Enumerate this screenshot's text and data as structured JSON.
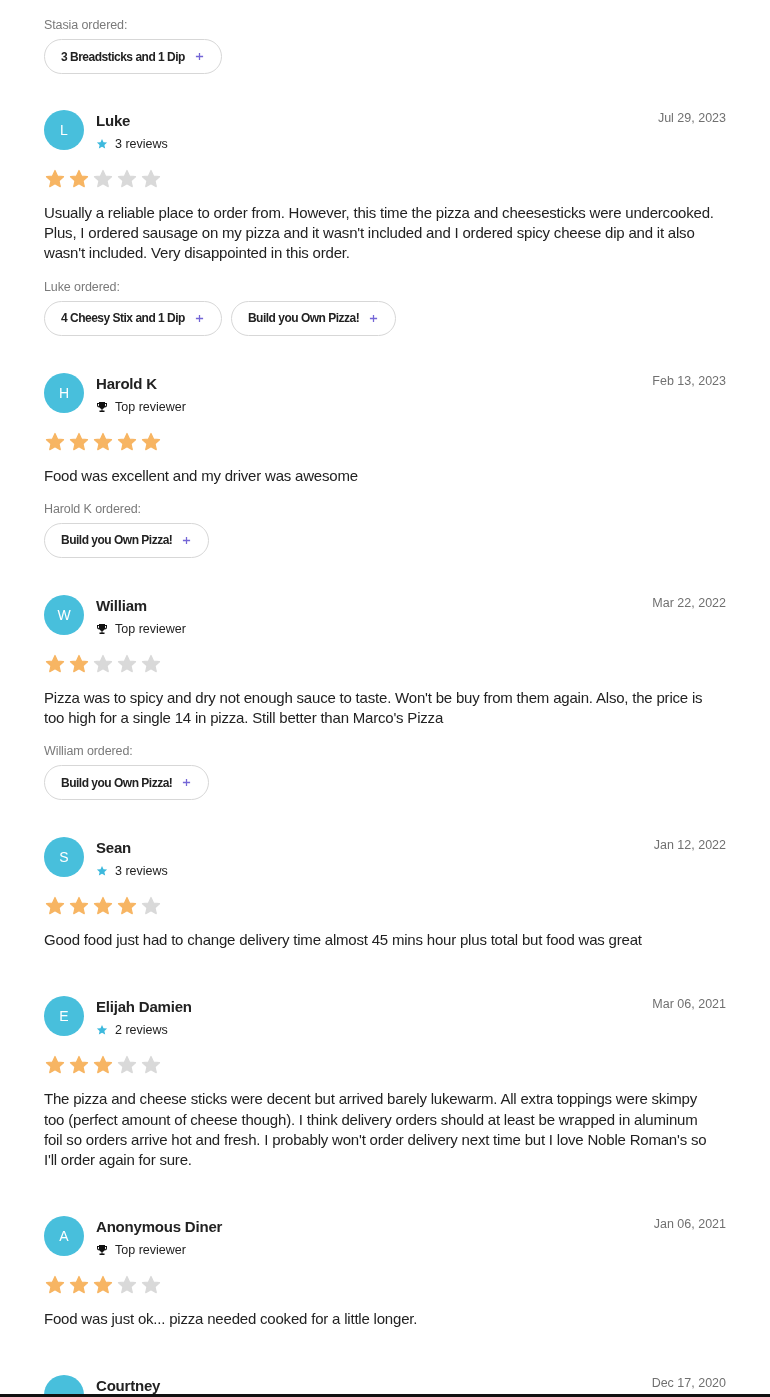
{
  "partial_review": {
    "ordered_label": "Stasia ordered:",
    "ordered_items": [
      "3 Breadsticks and 1 Dip"
    ]
  },
  "reviews": [
    {
      "initial": "L",
      "name": "Luke",
      "badge": {
        "kind": "reviews",
        "text": "3 reviews"
      },
      "date": "Jul 29, 2023",
      "stars": 2,
      "text": "Usually a reliable place to order from. However, this time the pizza and cheesesticks were undercooked. Plus, I ordered sausage on my pizza and it wasn't included and I ordered spicy cheese dip and it also wasn't included. Very disappointed in this order.",
      "ordered_label": "Luke ordered:",
      "ordered_items": [
        "4 Cheesy Stix and 1 Dip",
        "Build you Own Pizza!"
      ]
    },
    {
      "initial": "H",
      "name": "Harold K",
      "badge": {
        "kind": "top",
        "text": "Top reviewer"
      },
      "date": "Feb 13, 2023",
      "stars": 5,
      "text": "Food was excellent and my driver was awesome",
      "ordered_label": "Harold K ordered:",
      "ordered_items": [
        "Build you Own Pizza!"
      ]
    },
    {
      "initial": "W",
      "name": "William",
      "badge": {
        "kind": "top",
        "text": "Top reviewer"
      },
      "date": "Mar 22, 2022",
      "stars": 2,
      "text": "Pizza was to spicy and dry not enough sauce to taste. Won't be buy from them again. Also, the price is too high for a single 14 in pizza. Still better than Marco's Pizza",
      "ordered_label": "William ordered:",
      "ordered_items": [
        "Build you Own Pizza!"
      ]
    },
    {
      "initial": "S",
      "name": "Sean",
      "badge": {
        "kind": "reviews",
        "text": "3 reviews"
      },
      "date": "Jan 12, 2022",
      "stars": 4,
      "text": "Good food just had to change delivery time almost 45 mins hour plus total but food was great"
    },
    {
      "initial": "E",
      "name": "Elijah Damien",
      "badge": {
        "kind": "reviews",
        "text": "2 reviews"
      },
      "date": "Mar 06, 2021",
      "stars": 3,
      "text": "The pizza and cheese sticks were decent but arrived barely lukewarm. All extra toppings were skimpy too (perfect amount of cheese though). I think delivery orders should at least be wrapped in aluminum foil so orders arrive hot and fresh. I probably won't order delivery next time but I love Noble Roman's so I'll order again for sure."
    },
    {
      "initial": "A",
      "name": "Anonymous Diner",
      "badge": {
        "kind": "top",
        "text": "Top reviewer"
      },
      "date": "Jan 06, 2021",
      "stars": 3,
      "text": "Food was just ok... pizza needed cooked for a little longer."
    },
    {
      "name": "Courtney",
      "date": "Dec 17, 2020"
    }
  ]
}
